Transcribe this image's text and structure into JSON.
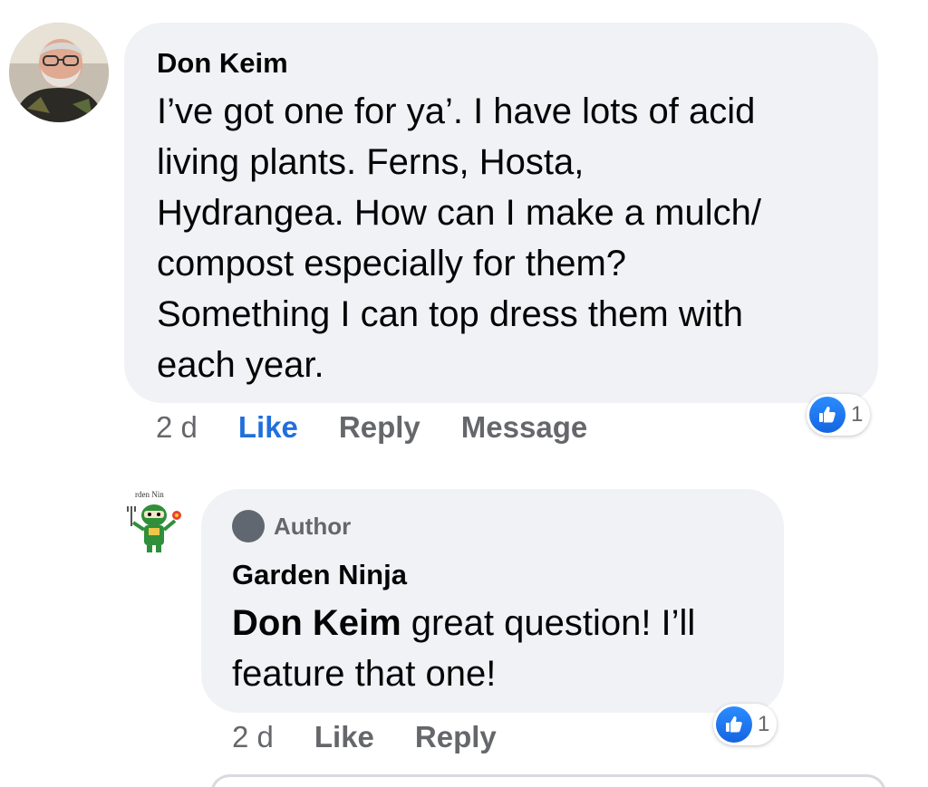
{
  "comment": {
    "author": "Don Keim",
    "text": "I’ve got one for ya’.  I have lots of acid\nliving plants.  Ferns, Hosta,\nHydrangea.  How can I make a mulch/\ncompost especially for them?\nSomething I can top dress them with\neach year.",
    "time": "2 d",
    "like_label": "Like",
    "reply_label": "Reply",
    "message_label": "Message",
    "reaction_count": "1"
  },
  "reply": {
    "badge": "Author",
    "author": "Garden Ninja",
    "mention": "Don Keim",
    "text_line1": " great question! I’ll",
    "text_line2": "feature that one!",
    "time": "2 d",
    "like_label": "Like",
    "reply_label": "Reply",
    "reaction_count": "1",
    "avatar_text": "rden Nin"
  },
  "colors": {
    "bubble": "#f0f2f5",
    "like_active": "#216fdb",
    "meta_text": "#65676b",
    "reaction_blue": "#1877f2"
  },
  "icons": {
    "reaction": "thumbs-up-icon",
    "author_badge": "author-badge-icon"
  }
}
